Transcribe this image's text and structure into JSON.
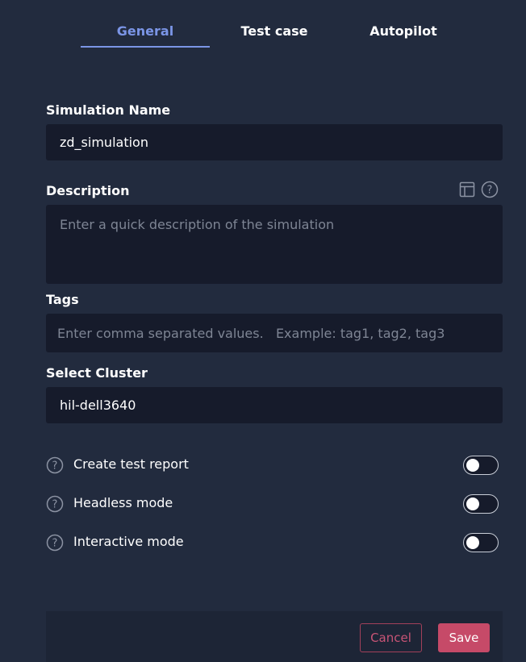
{
  "tabs": [
    {
      "label": "General",
      "active": true
    },
    {
      "label": "Test case",
      "active": false
    },
    {
      "label": "Autopilot",
      "active": false
    }
  ],
  "form": {
    "simulation_name": {
      "label": "Simulation Name",
      "value": "zd_simulation"
    },
    "description": {
      "label": "Description",
      "placeholder": "Enter a quick description of the simulation",
      "icons": [
        "layout-icon",
        "help-icon"
      ]
    },
    "tags": {
      "label": "Tags",
      "placeholder": "Enter comma separated values.   Example: tag1, tag2, tag3"
    },
    "cluster": {
      "label": "Select Cluster",
      "value": "hil-dell3640"
    }
  },
  "options": [
    {
      "label": "Create test report",
      "enabled": false
    },
    {
      "label": "Headless mode",
      "enabled": false
    },
    {
      "label": "Interactive mode",
      "enabled": false
    }
  ],
  "footer": {
    "cancel_label": "Cancel",
    "save_label": "Save"
  },
  "colors": {
    "background": "#222b3e",
    "field": "#161b2b",
    "accent": "#7b95e6",
    "save": "#c64a68",
    "cancel_border": "#a2405a"
  }
}
